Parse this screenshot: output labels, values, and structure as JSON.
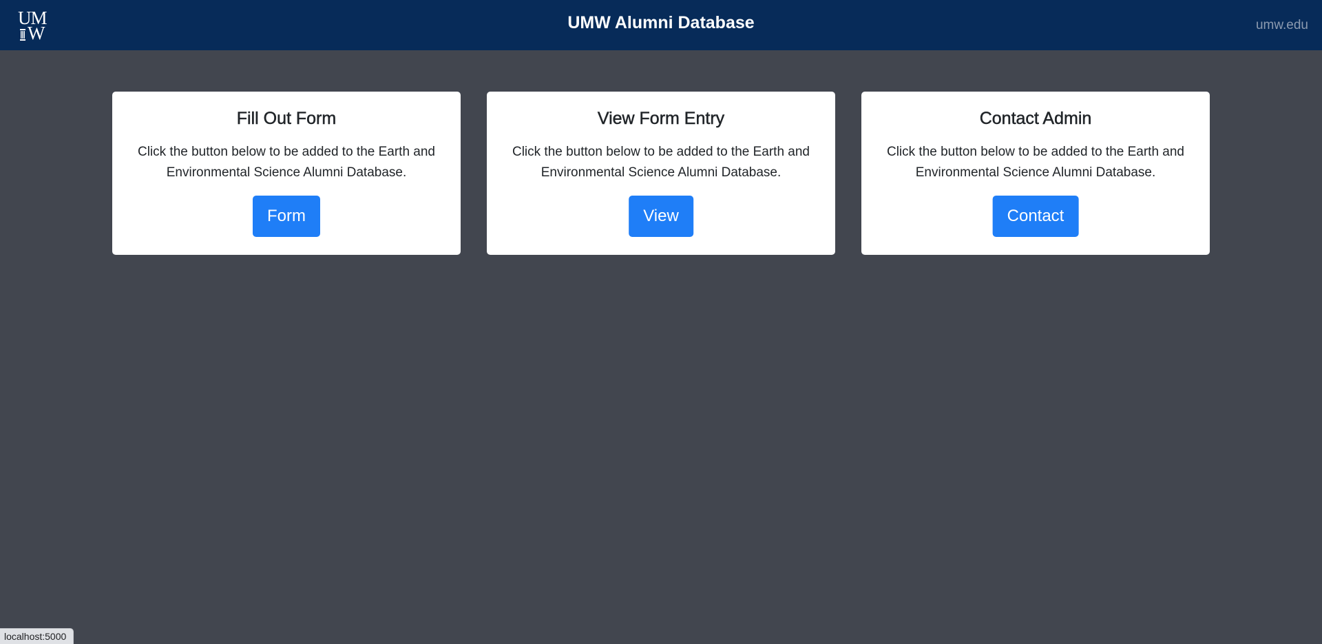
{
  "header": {
    "logo_line1": "UM",
    "logo_line2": "W",
    "title": "UMW Alumni Database",
    "site_link": "umw.edu"
  },
  "cards": [
    {
      "title": "Fill Out Form",
      "description": "Click the button below to be added to the Earth and Environmental Science Alumni Database.",
      "button_label": "Form"
    },
    {
      "title": "View Form Entry",
      "description": "Click the button below to be added to the Earth and Environmental Science Alumni Database.",
      "button_label": "View"
    },
    {
      "title": "Contact Admin",
      "description": "Click the button below to be added to the Earth and Environmental Science Alumni Database.",
      "button_label": "Contact"
    }
  ],
  "status_bar": {
    "url": "localhost:5000"
  },
  "colors": {
    "navbar": "#072b59",
    "background": "#42464f",
    "button": "#1f7ef7",
    "card": "#ffffff"
  }
}
